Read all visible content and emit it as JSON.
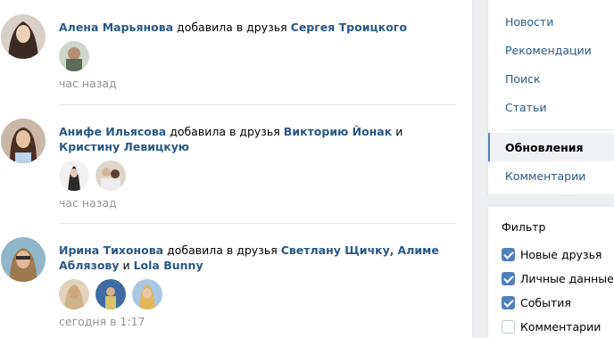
{
  "feed": {
    "items": [
      {
        "actor": "Алена Марьянова",
        "action": "добавила в друзья",
        "friends": [
          "Сергея Троицкого"
        ],
        "conjunctions": [],
        "time": "час назад"
      },
      {
        "actor": "Анифе Ильясова",
        "action": "добавила в друзья",
        "friends": [
          "Викторию Йонак",
          "Кристину Левицкую"
        ],
        "conjunctions": [
          "и"
        ],
        "time": "час назад"
      },
      {
        "actor": "Ирина Тихонова",
        "action": "добавила в друзья",
        "friends": [
          "Светлану Щичку,",
          "Алиме Аблязову",
          "Lola Bunny"
        ],
        "conjunctions": [
          "",
          "и"
        ],
        "time": "сегодня в 1:17"
      }
    ]
  },
  "menu": {
    "items": [
      "Новости",
      "Рекомендации",
      "Поиск",
      "Статьи"
    ],
    "active": "Обновления",
    "after": [
      "Комментарии"
    ]
  },
  "filter": {
    "title": "Фильтр",
    "options": [
      {
        "label": "Новые друзья",
        "checked": true
      },
      {
        "label": "Личные данные",
        "checked": true
      },
      {
        "label": "События",
        "checked": true
      },
      {
        "label": "Комментарии",
        "checked": false
      }
    ]
  },
  "colors": {
    "link": "#2a5885",
    "accent": "#5181b8",
    "muted": "#939393",
    "background": "#edeef0"
  }
}
